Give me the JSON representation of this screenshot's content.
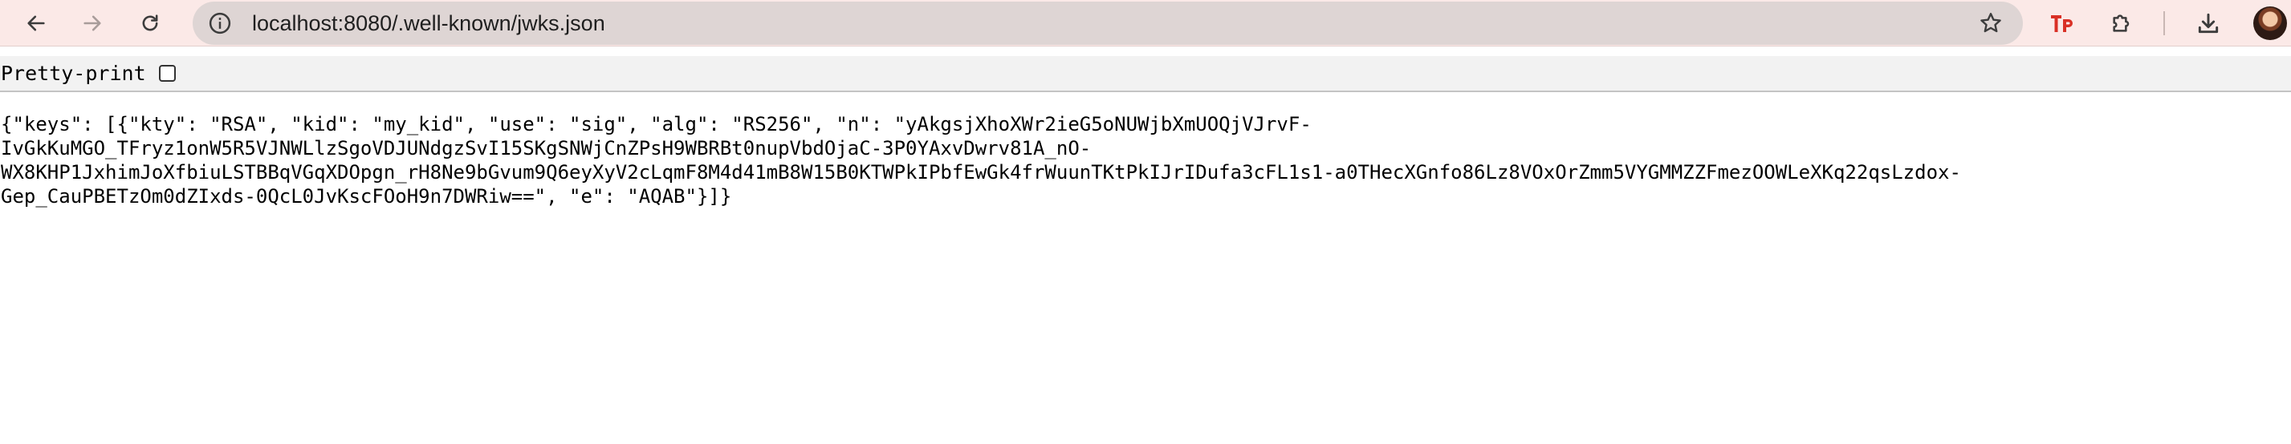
{
  "browser": {
    "url": "localhost:8080/.well-known/jwks.json",
    "icons": {
      "back": "back-arrow-icon",
      "forward": "forward-arrow-icon",
      "reload": "reload-icon",
      "site_info": "site-info-icon",
      "bookmark": "star-icon",
      "extension_tp": "tp-extension-icon",
      "extensions": "puzzle-icon",
      "downloads": "download-icon",
      "profile": "avatar"
    },
    "colors": {
      "toolbar_bg": "#fbe9e7",
      "omnibox_bg": "#ded5d4",
      "tp_red": "#d93025"
    }
  },
  "page": {
    "pretty_print_label": "Pretty-print",
    "pretty_print_checked": false,
    "json_lines": [
      "{\"keys\": [{\"kty\": \"RSA\", \"kid\": \"my_kid\", \"use\": \"sig\", \"alg\": \"RS256\", \"n\": \"yAkgsjXhoXWr2ieG5oNUWjbXmUOQjVJrvF-",
      "IvGkKuMGO_TFryz1onW5R5VJNWLlzSgoVDJUNdgzSvI15SKgSNWjCnZPsH9WBRBt0nupVbdOjaC-3P0YAxvDwrv81A_nO-",
      "WX8KHP1JxhimJoXfbiuLSTBBqVGqXDOpgn_rH8Ne9bGvum9Q6eyXyV2cLqmF8M4d41mB8W15B0KTWPkIPbfEwGk4frWuunTKtPkIJrIDufa3cFL1s1-a0THecXGnfo86Lz8VOxOrZmm5VYGMMZZFmezOOWLeXKq22qsLzdox-",
      "Gep_CauPBETzOm0dZIxds-0QcL0JvKscFOoH9n7DWRiw==\", \"e\": \"AQAB\"}]}"
    ]
  }
}
